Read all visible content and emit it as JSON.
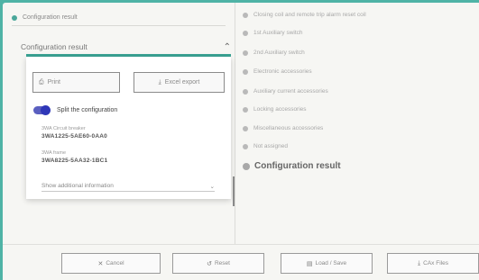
{
  "left": {
    "header_label": "Configuration result",
    "accordion_title": "Configuration result",
    "print_label": "Print",
    "excel_label": "Excel export",
    "split_label": "Split the configuration",
    "components": [
      {
        "label": "3WA Circuit breaker",
        "code": "3WA1225-5AE60-0AA0"
      },
      {
        "label": "3WA frame",
        "code": "3WA8225-5AA32-1BC1"
      }
    ],
    "show_more": "Show additional information"
  },
  "nav": {
    "items": [
      "Closing coil and remote trip alarm reset coil",
      "1st Auxiliary switch",
      "2nd Auxiliary switch",
      "Electronic accessories",
      "Auxiliary current accessories",
      "Locking accessories",
      "Miscellaneous accessories",
      "Not assigned"
    ],
    "active": "Configuration result"
  },
  "footer": {
    "cancel": "Cancel",
    "reset": "Reset",
    "load_save": "Load / Save",
    "cax": "CAx Files"
  },
  "colors": {
    "accent": "#3aa393",
    "toggle": "#2f37b8",
    "frame": "#4fb3a6"
  }
}
